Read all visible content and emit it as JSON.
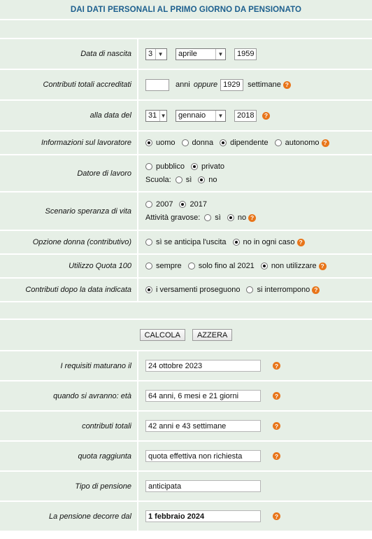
{
  "title": "DAI DATI PERSONALI AL PRIMO GIORNO DA PENSIONATO",
  "birth": {
    "label": "Data di nascita",
    "day": "3",
    "month": "aprile",
    "year": "1959"
  },
  "contrib": {
    "label": "Contributi totali accreditati",
    "anni_value": "",
    "anni_label": "anni",
    "oppure": "oppure",
    "settimane_value": "1929",
    "settimane_label": "settimane"
  },
  "alla_data": {
    "label": "alla data del",
    "day": "31",
    "month": "gennaio",
    "year": "2018"
  },
  "info": {
    "label": "Informazioni sul lavoratore",
    "opts": [
      "uomo",
      "donna",
      "dipendente",
      "autonomo"
    ]
  },
  "datore": {
    "label": "Datore di lavoro",
    "opts": [
      "pubblico",
      "privato"
    ],
    "scuola_label": "Scuola:",
    "scuola_opts": [
      "sì",
      "no"
    ]
  },
  "scenario": {
    "label": "Scenario speranza di vita",
    "opts": [
      "2007",
      "2017"
    ],
    "gravose_label": "Attività gravose:",
    "gravose_opts": [
      "sì",
      "no"
    ]
  },
  "opzione_donna": {
    "label": "Opzione donna (contributivo)",
    "opts": [
      "sì se anticipa l'uscita",
      "no in ogni caso"
    ]
  },
  "quota100": {
    "label": "Utilizzo Quota 100",
    "opts": [
      "sempre",
      "solo fino al 2021",
      "non utilizzare"
    ]
  },
  "dopo": {
    "label": "Contributi dopo la data indicata",
    "opts": [
      "i versamenti proseguono",
      "si interrompono"
    ]
  },
  "buttons": {
    "calcola": "CALCOLA",
    "azzera": "AZZERA"
  },
  "results": {
    "requisiti": {
      "label": "I requisiti maturano il",
      "value": "24 ottobre 2023"
    },
    "eta": {
      "label": "quando si avranno: età",
      "value": "64 anni, 6 mesi e 21 giorni"
    },
    "contributi": {
      "label": "contributi totali",
      "value": "42 anni e 43 settimane"
    },
    "quota": {
      "label": "quota raggiunta",
      "value": "quota effettiva non richiesta"
    },
    "tipo": {
      "label": "Tipo di pensione",
      "value": "anticipata"
    },
    "decorre": {
      "label": "La pensione decorre dal",
      "value": "1 febbraio 2024"
    }
  },
  "help_glyph": "?",
  "colors": {
    "background": "#e6efe6",
    "title": "#1d5f8e",
    "help": "#e8751a"
  }
}
